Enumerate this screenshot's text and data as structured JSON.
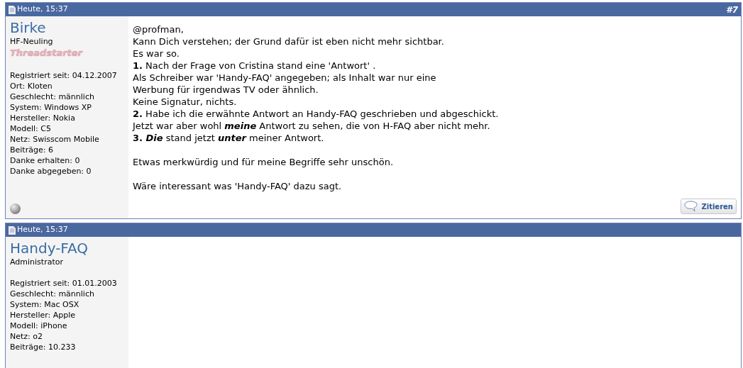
{
  "posts": [
    {
      "date": "Heute, 15:37",
      "number": "#7",
      "user": {
        "name": "Birke",
        "rank": "HF-Neuling",
        "badge": "Threadstarter",
        "online": false,
        "details": [
          "Registriert seit: 04.12.2007",
          "Ort: Kloten",
          "Geschlecht: männlich",
          "System: Windows XP",
          "Hersteller: Nokia",
          "Modell: C5",
          "Netz: Swisscom Mobile",
          "Beiträge: 6",
          "Danke erhalten: 0",
          "Danke abgegeben: 0"
        ]
      },
      "message": [
        [
          "@profman,",
          "Kann Dich verstehen; der Grund dafür ist eben nicht mehr sichtbar.",
          "Es war so.",
          "**1.** Nach der Frage von Cristina stand eine 'Antwort' .",
          "Als Schreiber war 'Handy-FAQ' angegeben; als Inhalt war nur eine",
          "Werbung für irgendwas TV oder ähnlich.",
          "Keine Signatur, nichts.",
          "**2.** Habe ich die erwähnte Antwort an Handy-FAQ geschrieben und abgeschickt.",
          [
            {
              "text": "Jetzt war aber wohl "
            },
            {
              "text": "meine",
              "bold": true,
              "italic": true
            },
            {
              "text": " Antwort zu sehen, die von H-FAQ aber nicht mehr."
            }
          ],
          [
            {
              "text": "3. ",
              "bold": true
            },
            {
              "text": "Die",
              "bold": true,
              "italic": true
            },
            {
              "text": " stand jetzt "
            },
            {
              "text": "unter",
              "bold": true,
              "italic": true
            },
            {
              "text": " meiner Antwort."
            }
          ]
        ],
        [
          "Etwas merkwürdig und für meine Begriffe sehr unschön."
        ],
        [
          "Wäre interessant was 'Handy-FAQ' dazu sagt."
        ]
      ],
      "quote_button": "Zitieren"
    },
    {
      "date": "Heute, 15:37",
      "user": {
        "name": "Handy-FAQ",
        "rank": "Administrator",
        "details": [
          "Registriert seit: 01.01.2003",
          "Geschlecht: männlich",
          "System: Mac OSX",
          "Hersteller: Apple",
          "Modell: iPhone",
          "Netz: o2",
          "Beiträge: 10.233"
        ]
      }
    }
  ]
}
